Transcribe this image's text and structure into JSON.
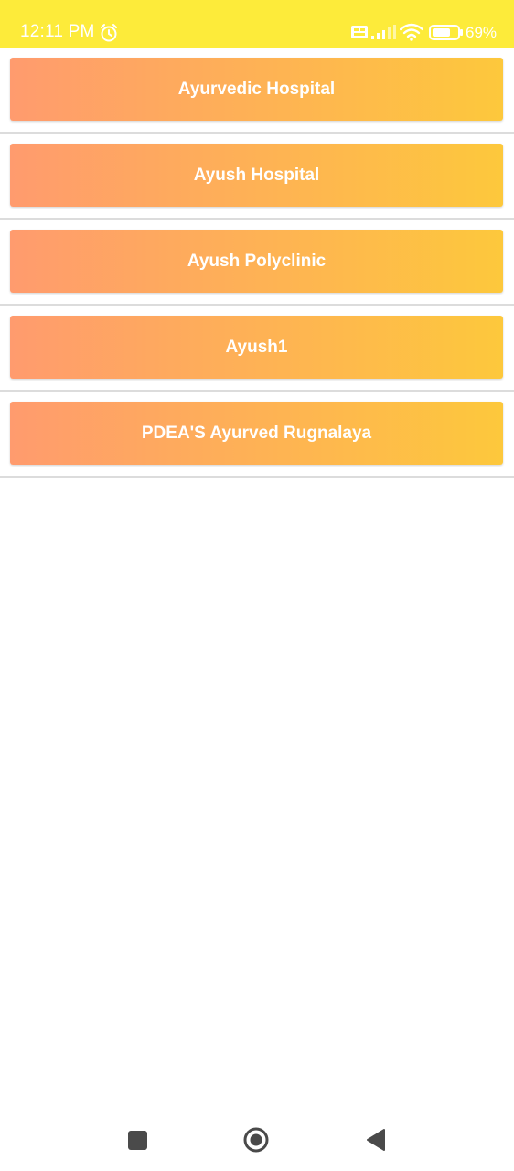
{
  "status_bar": {
    "time": "12:11 PM",
    "battery_percent": "69%",
    "background_color": "#fdeb3a",
    "icons": [
      "alarm-icon",
      "sim-volte-icon",
      "signal-icon",
      "wifi-icon",
      "battery-icon"
    ]
  },
  "hospitals": [
    {
      "label": "Ayurvedic Hospital"
    },
    {
      "label": "Ayush Hospital"
    },
    {
      "label": "Ayush Polyclinic"
    },
    {
      "label": "Ayush1"
    },
    {
      "label": "PDEA'S Ayurved Rugnalaya"
    }
  ],
  "button_gradient": {
    "start": "#ff9b6e",
    "end": "#fdc83c"
  },
  "nav_bar": {
    "icons": [
      "recents-square-icon",
      "home-circle-icon",
      "back-triangle-icon"
    ]
  }
}
